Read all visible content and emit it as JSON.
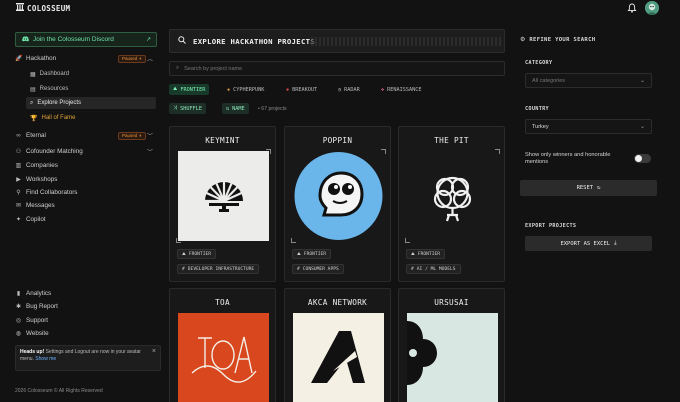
{
  "app": {
    "name": "COLOSSEUM"
  },
  "sidebar": {
    "discord_label": "Join the Colosseum Discord",
    "hackathon": {
      "label": "Hackathon",
      "badge": "Paused"
    },
    "hackathon_items": [
      {
        "label": "Dashboard"
      },
      {
        "label": "Resources"
      },
      {
        "label": "Explore Projects"
      },
      {
        "label": "Hall of Fame"
      }
    ],
    "eternal": {
      "label": "Eternal",
      "badge": "Paused"
    },
    "main_items": [
      {
        "label": "Cofounder Matching"
      },
      {
        "label": "Companies"
      },
      {
        "label": "Workshops"
      },
      {
        "label": "Find Collaborators"
      },
      {
        "label": "Messages"
      },
      {
        "label": "Copilot"
      }
    ],
    "footer_items": [
      {
        "label": "Analytics"
      },
      {
        "label": "Bug Report"
      },
      {
        "label": "Support"
      },
      {
        "label": "Website"
      }
    ],
    "notice": {
      "title": "Heads up!",
      "text": "Settings and Logout are now in your avatar menu.",
      "link": "Show me"
    },
    "copyright": "2026 Colosseum © All Rights Reserved"
  },
  "main": {
    "title": "EXPLORE HACKATHON PROJECTS",
    "search_placeholder": "Search by project name",
    "hackathons": [
      {
        "label": "FRONTIER"
      },
      {
        "label": "CYPHERPUNK"
      },
      {
        "label": "BREAKOUT"
      },
      {
        "label": "RADAR"
      },
      {
        "label": "RENAISSANCE"
      }
    ],
    "shuffle_label": "SHUFFLE",
    "name_label": "NAME",
    "count": "• 67 projects",
    "projects": [
      {
        "name": "KEYMINT",
        "tags": [
          "FRONTIER",
          "DEVELOPER INFRASTRUCTURE"
        ]
      },
      {
        "name": "POPPIN",
        "tags": [
          "FRONTIER",
          "CONSUMER APPS"
        ]
      },
      {
        "name": "THE PIT",
        "tags": [
          "FRONTIER",
          "AI / ML MODELS"
        ]
      },
      {
        "name": "TOA",
        "tags": []
      },
      {
        "name": "AKCA NETWORK",
        "tags": []
      },
      {
        "name": "URSUSAI",
        "tags": []
      }
    ]
  },
  "filters": {
    "title": "REFINE YOUR SEARCH",
    "category_label": "CATEGORY",
    "category_placeholder": "All categories",
    "country_label": "COUNTRY",
    "country_value": "Turkey",
    "winners_label": "Show only winners and honorable mentions",
    "reset_label": "RESET",
    "export_title": "EXPORT PROJECTS",
    "export_label": "EXPORT AS EXCEL"
  },
  "colors": {
    "accent_green": "#6fe3a6",
    "paused_orange": "#e6903c",
    "hall_of_fame": "#e3a336",
    "poppin_blue": "#6ab5ea",
    "toa_red": "#d9471f"
  }
}
